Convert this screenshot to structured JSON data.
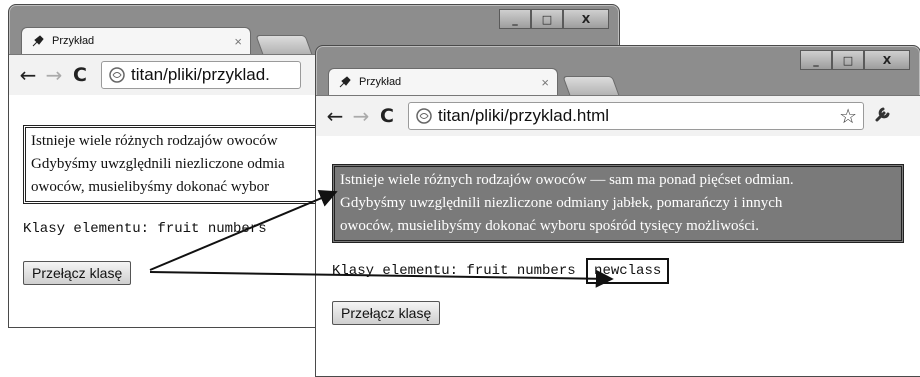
{
  "window_controls": {
    "minimize": "_",
    "maximize": "□",
    "close": "X"
  },
  "back_window": {
    "tab": {
      "title": "Przykład",
      "close": "×"
    },
    "toolbar": {
      "back": "←",
      "forward": "→",
      "reload": "C",
      "url": "titan/pliki/przyklad."
    },
    "paragraph_lines": [
      "Istnieje wiele różnych rodzajów owoców",
      "Gdybyśmy uwzględnili niezliczone odmia",
      "owoców, musielibyśmy dokonać wybor"
    ],
    "class_line": "Klasy elementu: fruit numbers",
    "button": "Przełącz klasę"
  },
  "front_window": {
    "tab": {
      "title": "Przykład",
      "close": "×"
    },
    "toolbar": {
      "back": "←",
      "forward": "→",
      "reload": "C",
      "url": "titan/pliki/przyklad.html",
      "star": "☆"
    },
    "paragraph_lines": [
      "Istnieje wiele różnych rodzajów owoców — sam ma ponad pięćset odmian.",
      "Gdybyśmy uwzględnili niezliczone odmiany jabłek, pomarańczy i innych",
      "owoców, musielibyśmy dokonać wyboru spośród tysięcy możliwości."
    ],
    "class_line": "Klasy elementu: fruit numbers",
    "new_class": "newclass",
    "button": "Przełącz klasę"
  }
}
